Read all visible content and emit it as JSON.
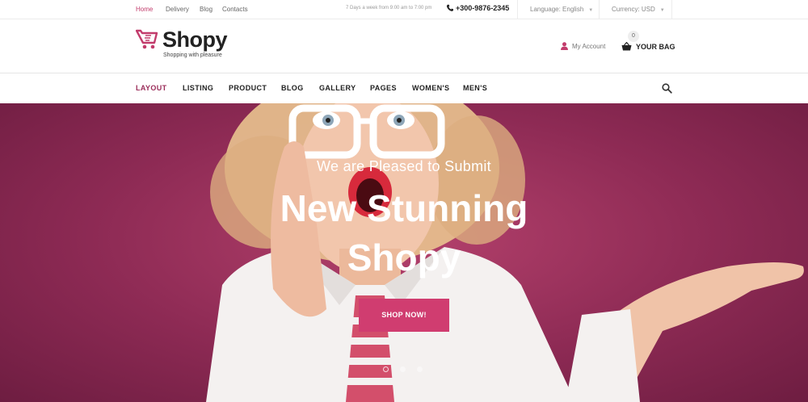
{
  "topbar": {
    "links": [
      "Home",
      "Delivery",
      "Blog",
      "Contacts"
    ],
    "hours": "7 Days a week from 9:00 am to 7:00 pm",
    "phone": "+300-9876-2345",
    "language": "Language: English",
    "currency": "Currency: USD"
  },
  "header": {
    "logo_name": "Shopy",
    "logo_tagline": "Shopping with pleasure",
    "account_label": "My Account",
    "bag_label": "YOUR BAG",
    "bag_count": "0"
  },
  "nav": {
    "items": [
      "LAYOUT",
      "LISTING",
      "PRODUCT",
      "BLOG",
      "GALLERY",
      "PAGES",
      "WOMEN'S",
      "MEN'S"
    ],
    "active": "LAYOUT"
  },
  "hero": {
    "kicker": "We are Pleased to Submit",
    "title_line1": "New Stunning",
    "title_line2": "Shopy",
    "cta": "SHOP NOW!",
    "slides": 3,
    "active_slide": 1
  },
  "colors": {
    "accent": "#c23c6c",
    "button": "#d03d70",
    "hero_background": "#8d2a54"
  }
}
